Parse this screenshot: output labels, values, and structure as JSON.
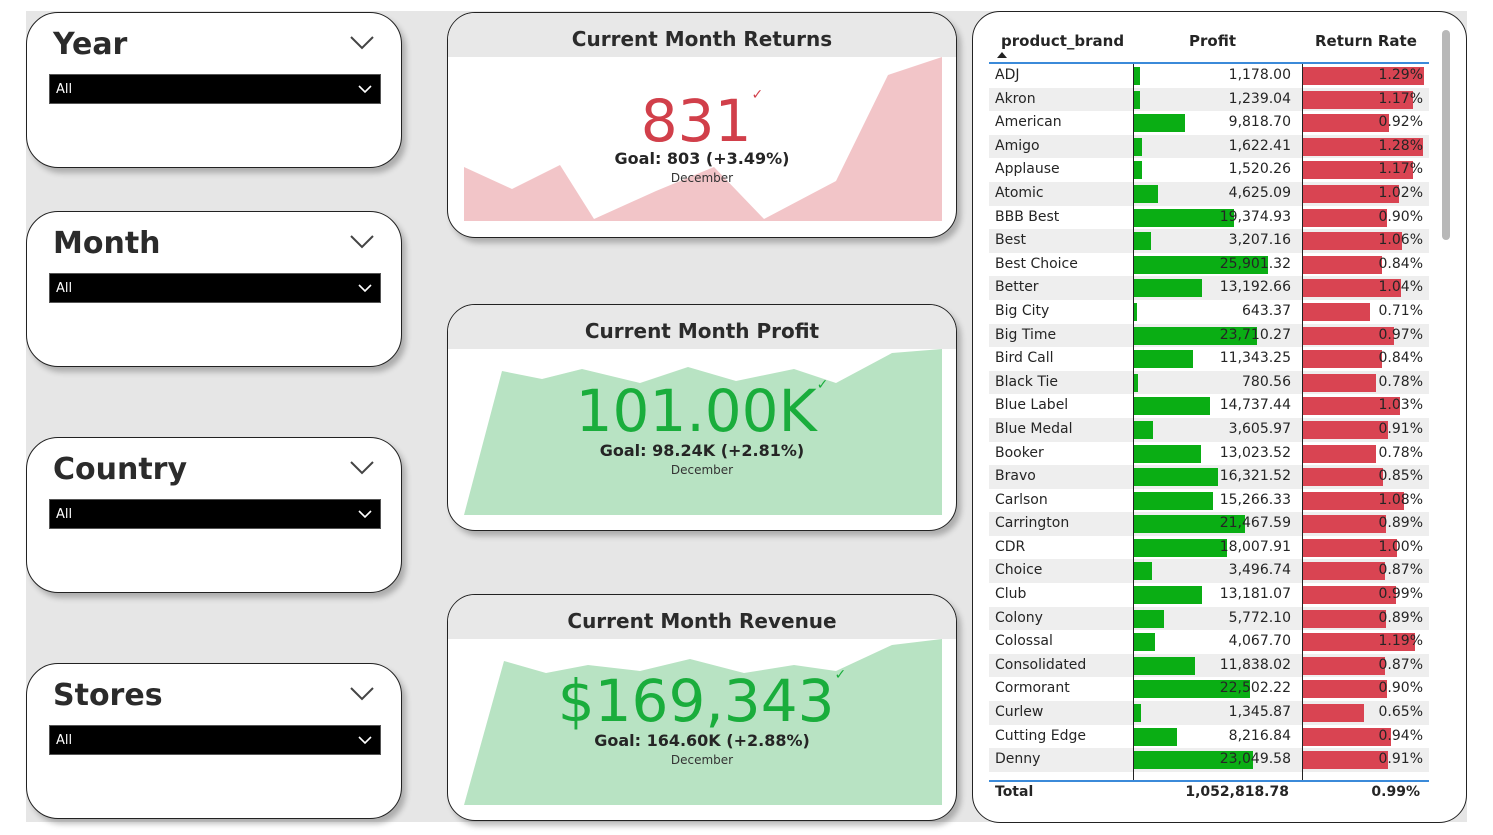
{
  "slicers": [
    {
      "title": "Year",
      "value": "All"
    },
    {
      "title": "Month",
      "value": "All"
    },
    {
      "title": "Country",
      "value": "All"
    },
    {
      "title": "Stores",
      "value": "All"
    }
  ],
  "kpis": {
    "returns": {
      "title": "Current Month Returns",
      "value": "831",
      "goal": "Goal: 803 (+3.49%)",
      "period": "December",
      "color": "#d13f4a",
      "area_color": "#f2c5c8"
    },
    "profit": {
      "title": "Current Month Profit",
      "value": "101.00K",
      "goal": "Goal: 98.24K (+2.81%)",
      "period": "December",
      "color": "#1aad3c",
      "area_color": "#b8e3c3"
    },
    "revenue": {
      "title": "Current Month Revenue",
      "value": "$169,343",
      "goal": "Goal: 164.60K (+2.88%)",
      "period": "December",
      "color": "#1aad3c",
      "area_color": "#b8e3c3"
    }
  },
  "table": {
    "columns": {
      "brand": "product_brand",
      "profit": "Profit",
      "rate": "Return Rate"
    },
    "rows": [
      {
        "brand": "ADJ",
        "profit": "1,178.00",
        "profit_num": 1178.0,
        "rate": "1.29%",
        "rate_num": 1.29
      },
      {
        "brand": "Akron",
        "profit": "1,239.04",
        "profit_num": 1239.04,
        "rate": "1.17%",
        "rate_num": 1.17
      },
      {
        "brand": "American",
        "profit": "9,818.70",
        "profit_num": 9818.7,
        "rate": "0.92%",
        "rate_num": 0.92
      },
      {
        "brand": "Amigo",
        "profit": "1,622.41",
        "profit_num": 1622.41,
        "rate": "1.28%",
        "rate_num": 1.28
      },
      {
        "brand": "Applause",
        "profit": "1,520.26",
        "profit_num": 1520.26,
        "rate": "1.17%",
        "rate_num": 1.17
      },
      {
        "brand": "Atomic",
        "profit": "4,625.09",
        "profit_num": 4625.09,
        "rate": "1.02%",
        "rate_num": 1.02
      },
      {
        "brand": "BBB Best",
        "profit": "19,374.93",
        "profit_num": 19374.93,
        "rate": "0.90%",
        "rate_num": 0.9
      },
      {
        "brand": "Best",
        "profit": "3,207.16",
        "profit_num": 3207.16,
        "rate": "1.06%",
        "rate_num": 1.06
      },
      {
        "brand": "Best Choice",
        "profit": "25,901.32",
        "profit_num": 25901.32,
        "rate": "0.84%",
        "rate_num": 0.84
      },
      {
        "brand": "Better",
        "profit": "13,192.66",
        "profit_num": 13192.66,
        "rate": "1.04%",
        "rate_num": 1.04
      },
      {
        "brand": "Big City",
        "profit": "643.37",
        "profit_num": 643.37,
        "rate": "0.71%",
        "rate_num": 0.71
      },
      {
        "brand": "Big Time",
        "profit": "23,710.27",
        "profit_num": 23710.27,
        "rate": "0.97%",
        "rate_num": 0.97
      },
      {
        "brand": "Bird Call",
        "profit": "11,343.25",
        "profit_num": 11343.25,
        "rate": "0.84%",
        "rate_num": 0.84
      },
      {
        "brand": "Black Tie",
        "profit": "780.56",
        "profit_num": 780.56,
        "rate": "0.78%",
        "rate_num": 0.78
      },
      {
        "brand": "Blue Label",
        "profit": "14,737.44",
        "profit_num": 14737.44,
        "rate": "1.03%",
        "rate_num": 1.03
      },
      {
        "brand": "Blue Medal",
        "profit": "3,605.97",
        "profit_num": 3605.97,
        "rate": "0.91%",
        "rate_num": 0.91
      },
      {
        "brand": "Booker",
        "profit": "13,023.52",
        "profit_num": 13023.52,
        "rate": "0.78%",
        "rate_num": 0.78
      },
      {
        "brand": "Bravo",
        "profit": "16,321.52",
        "profit_num": 16321.52,
        "rate": "0.85%",
        "rate_num": 0.85
      },
      {
        "brand": "Carlson",
        "profit": "15,266.33",
        "profit_num": 15266.33,
        "rate": "1.08%",
        "rate_num": 1.08
      },
      {
        "brand": "Carrington",
        "profit": "21,467.59",
        "profit_num": 21467.59,
        "rate": "0.89%",
        "rate_num": 0.89
      },
      {
        "brand": "CDR",
        "profit": "18,007.91",
        "profit_num": 18007.91,
        "rate": "1.00%",
        "rate_num": 1.0
      },
      {
        "brand": "Choice",
        "profit": "3,496.74",
        "profit_num": 3496.74,
        "rate": "0.87%",
        "rate_num": 0.87
      },
      {
        "brand": "Club",
        "profit": "13,181.07",
        "profit_num": 13181.07,
        "rate": "0.99%",
        "rate_num": 0.99
      },
      {
        "brand": "Colony",
        "profit": "5,772.10",
        "profit_num": 5772.1,
        "rate": "0.89%",
        "rate_num": 0.89
      },
      {
        "brand": "Colossal",
        "profit": "4,067.70",
        "profit_num": 4067.7,
        "rate": "1.19%",
        "rate_num": 1.19
      },
      {
        "brand": "Consolidated",
        "profit": "11,838.02",
        "profit_num": 11838.02,
        "rate": "0.87%",
        "rate_num": 0.87
      },
      {
        "brand": "Cormorant",
        "profit": "22,502.22",
        "profit_num": 22502.22,
        "rate": "0.90%",
        "rate_num": 0.9
      },
      {
        "brand": "Curlew",
        "profit": "1,345.87",
        "profit_num": 1345.87,
        "rate": "0.65%",
        "rate_num": 0.65
      },
      {
        "brand": "Cutting Edge",
        "profit": "8,216.84",
        "profit_num": 8216.84,
        "rate": "0.94%",
        "rate_num": 0.94
      },
      {
        "brand": "Denny",
        "profit": "23,049.58",
        "profit_num": 23049.58,
        "rate": "0.91%",
        "rate_num": 0.91
      }
    ],
    "total": {
      "label": "Total",
      "profit": "1,052,818.78",
      "rate": "0.99%"
    },
    "colors": {
      "profit_bar": "#0aae14",
      "rate_bar": "#d94452"
    }
  }
}
